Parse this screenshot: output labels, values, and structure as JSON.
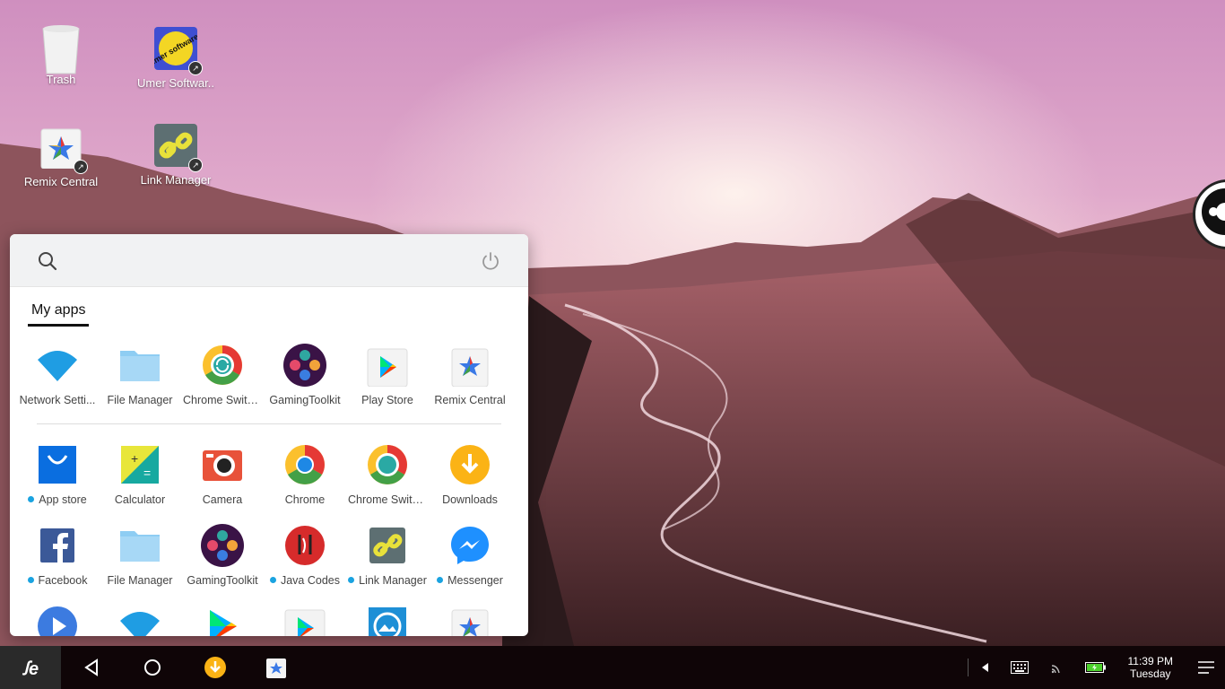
{
  "desktop": {
    "icons": [
      {
        "label": "Trash",
        "icon": "trash-icon"
      },
      {
        "label": "Umer Softwar..",
        "icon": "umer-software-icon"
      },
      {
        "label": "Remix Central",
        "icon": "remix-central-icon"
      },
      {
        "label": "Link Manager",
        "icon": "link-manager-icon"
      }
    ],
    "logo_badge": "umer softwares"
  },
  "start_menu": {
    "tab_label": "My apps",
    "pinned": [
      {
        "label": "Network Setti...",
        "icon": "wifi-icon"
      },
      {
        "label": "File Manager",
        "icon": "folder-icon"
      },
      {
        "label": "Chrome Switc...",
        "icon": "chrome-switch-icon"
      },
      {
        "label": "GamingToolkit",
        "icon": "gaming-toolkit-icon"
      },
      {
        "label": "Play Store",
        "icon": "play-store-icon"
      },
      {
        "label": "Remix Central",
        "icon": "remix-central-icon"
      }
    ],
    "apps_row1": [
      {
        "label": "App store",
        "icon": "app-store-icon",
        "new": true
      },
      {
        "label": "Calculator",
        "icon": "calculator-icon",
        "new": false
      },
      {
        "label": "Camera",
        "icon": "camera-icon",
        "new": false
      },
      {
        "label": "Chrome",
        "icon": "chrome-icon",
        "new": false
      },
      {
        "label": "Chrome Switc...",
        "icon": "chrome-switch-icon",
        "new": false
      },
      {
        "label": "Downloads",
        "icon": "downloads-icon",
        "new": false
      }
    ],
    "apps_row2": [
      {
        "label": "Facebook",
        "icon": "facebook-icon",
        "new": true
      },
      {
        "label": "File Manager",
        "icon": "folder-icon",
        "new": false
      },
      {
        "label": "GamingToolkit",
        "icon": "gaming-toolkit-icon",
        "new": false
      },
      {
        "label": "Java Codes",
        "icon": "java-codes-icon",
        "new": true
      },
      {
        "label": "Link Manager",
        "icon": "link-manager-icon",
        "new": true
      },
      {
        "label": "Messenger",
        "icon": "messenger-icon",
        "new": true
      }
    ],
    "apps_row3_icons": [
      "media-player-icon",
      "wifi-icon",
      "play-store-icon",
      "play-store-icon",
      "gallery-icon",
      "remix-central-icon"
    ]
  },
  "taskbar": {
    "start_label": "ꭍe",
    "time": "11:39 PM",
    "day": "Tuesday"
  },
  "colors": {
    "accent_dot": "#1aa3e0",
    "taskbar_bg": "#0f0507"
  }
}
